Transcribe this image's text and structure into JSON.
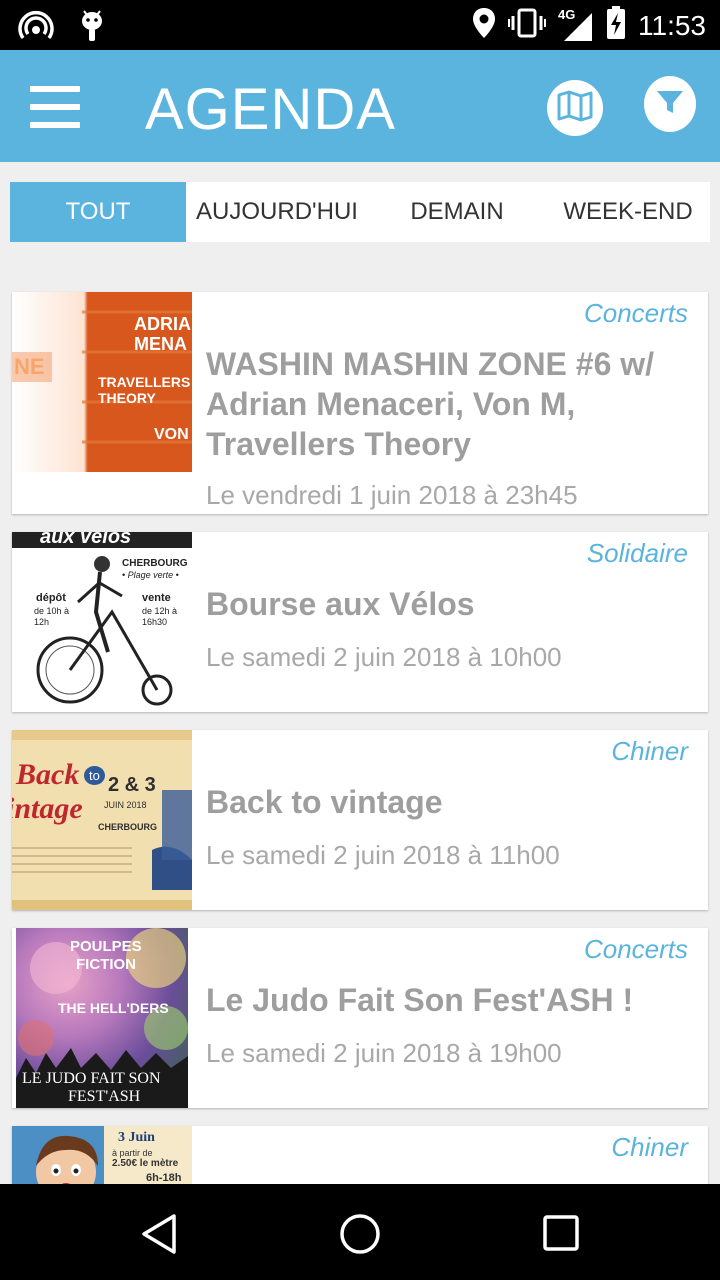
{
  "status": {
    "time": "11:53",
    "network": "4G"
  },
  "header": {
    "title": "AGENDA",
    "map_icon": "map-icon",
    "filter_icon": "filter-icon"
  },
  "tabs": [
    {
      "label": "TOUT",
      "active": true
    },
    {
      "label": "AUJOURD'HUI",
      "active": false
    },
    {
      "label": "DEMAIN",
      "active": false
    },
    {
      "label": "WEEK-END",
      "active": false
    }
  ],
  "events": [
    {
      "category": "Concerts",
      "title": "WASHIN MASHIN ZONE #6 w/ Adrian Menaceri, Von M, Travellers Theory",
      "date": "Le vendredi 1 juin 2018 à 23h45",
      "thumb_text": {
        "l1": "ADRIA",
        "l2": "MENA",
        "l3": "TRAVELLERS",
        "l4": "THEORY",
        "l5": "VON",
        "l6": "NE"
      }
    },
    {
      "category": "Solidaire",
      "title": "Bourse aux Vélos",
      "date": "Le samedi 2 juin 2018 à 10h00",
      "thumb_text": {
        "l1": "aux vélos",
        "l2": "CHERBOURG",
        "l3": "• Plage verte •",
        "l4": "dépôt",
        "l5": "de 10h à 12h",
        "l6": "vente",
        "l7": "de 12h à 16h30"
      }
    },
    {
      "category": "Chiner",
      "title": "Back to vintage",
      "date": "Le samedi 2 juin 2018 à 11h00",
      "thumb_text": {
        "l1": "Back",
        "l2": "to",
        "l3": "intage",
        "l4": "2 & 3",
        "l5": "JUIN 2018",
        "l6": "CHERBOURG"
      }
    },
    {
      "category": "Concerts",
      "title": "Le Judo Fait Son Fest'ASH !",
      "date": "Le samedi 2 juin 2018 à 19h00",
      "thumb_text": {
        "l1": "POULPES",
        "l2": "FICTION",
        "l3": "THE HELL'DERS",
        "l4": "LE JUDO FAIT SON",
        "l5": "FEST'ASH"
      }
    },
    {
      "category": "Chiner",
      "title": "",
      "date": "",
      "thumb_text": {
        "l1": "3 Juin",
        "l2": "à partir de",
        "l3": "2.50€ le mètre",
        "l4": "6h-18h"
      }
    }
  ]
}
